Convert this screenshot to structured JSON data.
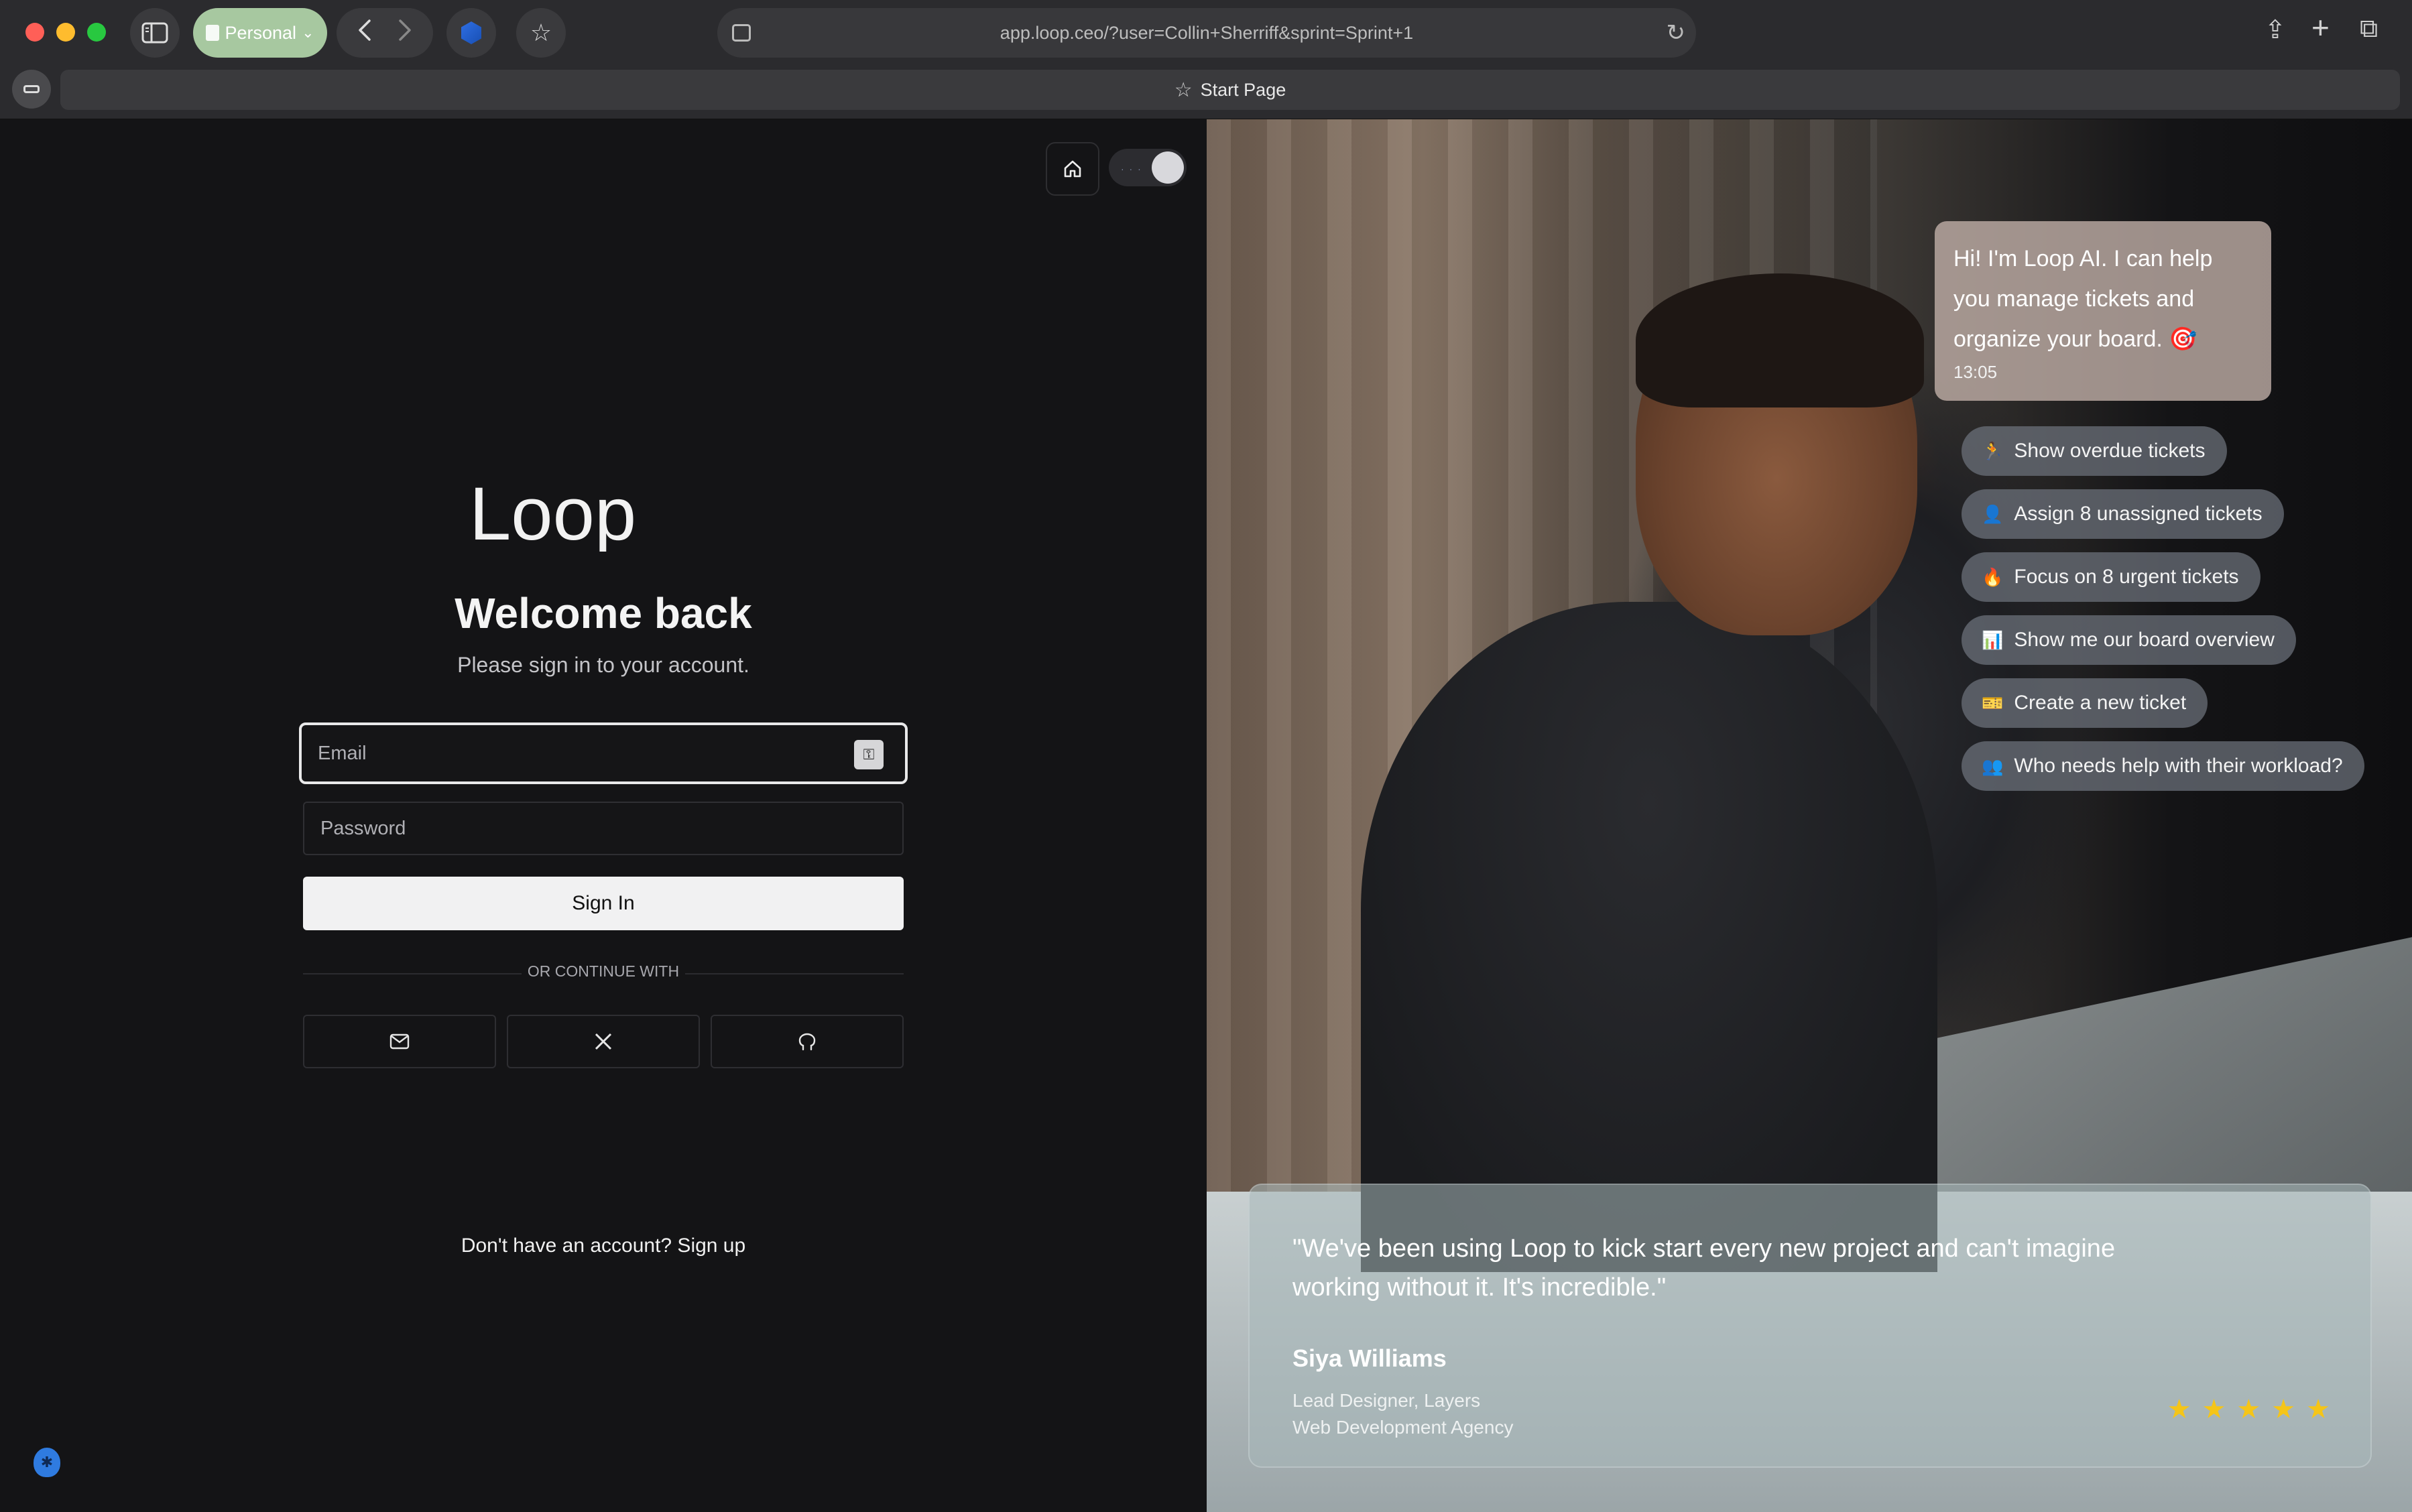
{
  "browser": {
    "profile": "Personal",
    "url": "app.loop.ceo/?user=Collin+Sherriff&sprint=Sprint+1",
    "tab_title": "Start Page"
  },
  "auth": {
    "brand": "Loop",
    "welcome": "Welcome back",
    "subtitle": "Please sign in to your account.",
    "email_placeholder": "Email",
    "password_placeholder": "Password",
    "signin_label": "Sign In",
    "divider": "OR CONTINUE WITH",
    "signup_text": "Don't have an account? Sign up"
  },
  "hero": {
    "ai_message": "Hi! I'm Loop AI. I can help you manage tickets and organize your board. 🎯",
    "ai_time": "13:05",
    "suggestions": [
      {
        "icon": "🏃",
        "label": "Show overdue tickets"
      },
      {
        "icon": "👤",
        "label": "Assign 8 unassigned tickets"
      },
      {
        "icon": "🔥",
        "label": "Focus on 8 urgent tickets"
      },
      {
        "icon": "📊",
        "label": "Show me our board overview"
      },
      {
        "icon": "🎫",
        "label": "Create a new ticket"
      },
      {
        "icon": "👥",
        "label": "Who needs help with their workload?"
      }
    ],
    "testimonial": {
      "quote": "\"We've been using Loop to kick start every new project and can't imagine working without it. It's incredible.\"",
      "name": "Siya Williams",
      "role_line1": "Lead Designer, Layers",
      "role_line2": "Web Development Agency",
      "rating": 5
    }
  },
  "colors": {
    "star": "#f5c518",
    "profile_pill": "#a7c8a0",
    "panel_bg": "#141416"
  }
}
